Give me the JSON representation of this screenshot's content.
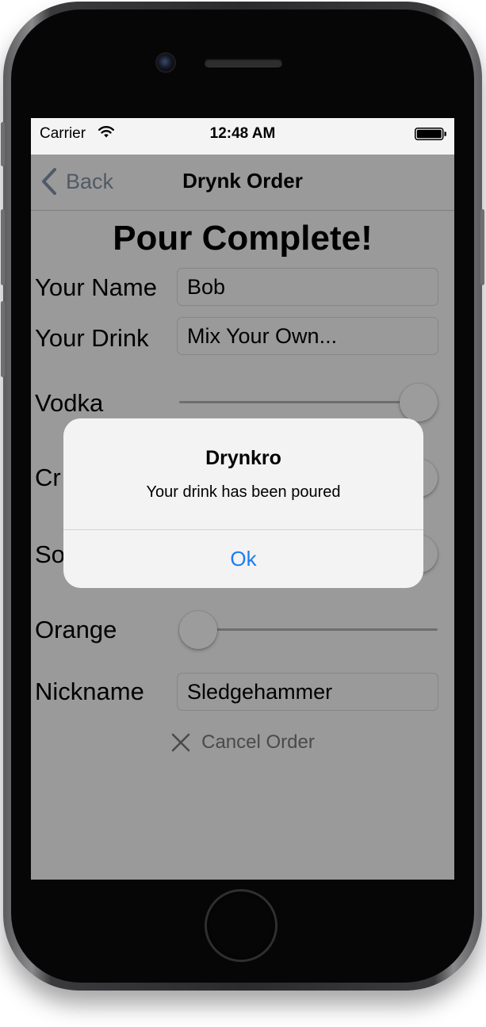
{
  "status_bar": {
    "carrier": "Carrier",
    "time": "12:48 AM",
    "wifi_icon": "wifi-icon",
    "battery_icon": "battery-icon"
  },
  "nav": {
    "back_label": "Back",
    "back_icon": "chevron-left-icon",
    "title": "Drynk Order"
  },
  "page": {
    "heading": "Pour Complete!"
  },
  "form": {
    "name": {
      "label": "Your Name",
      "value": "Bob"
    },
    "drink": {
      "label": "Your Drink",
      "value": "Mix Your Own..."
    },
    "vodka": {
      "label": "Vodka",
      "level": 1.0
    },
    "cranberry": {
      "label": "Cr",
      "level": 1.0
    },
    "soda": {
      "label": "So",
      "level": 1.0
    },
    "orange": {
      "label": "Orange",
      "level": 0.0
    },
    "nickname": {
      "label": "Nickname",
      "value": "Sledgehammer"
    }
  },
  "cancel": {
    "label": "Cancel Order",
    "icon": "close-icon"
  },
  "alert": {
    "title": "Drynkro",
    "message": "Your drink has been poured",
    "button_label": "Ok",
    "button_color": "#1a7cf4"
  },
  "colors": {
    "dimmed_background": "#9a9a9a",
    "status_bar_background": "#f4f4f4",
    "alert_background": "#f3f3f3"
  }
}
